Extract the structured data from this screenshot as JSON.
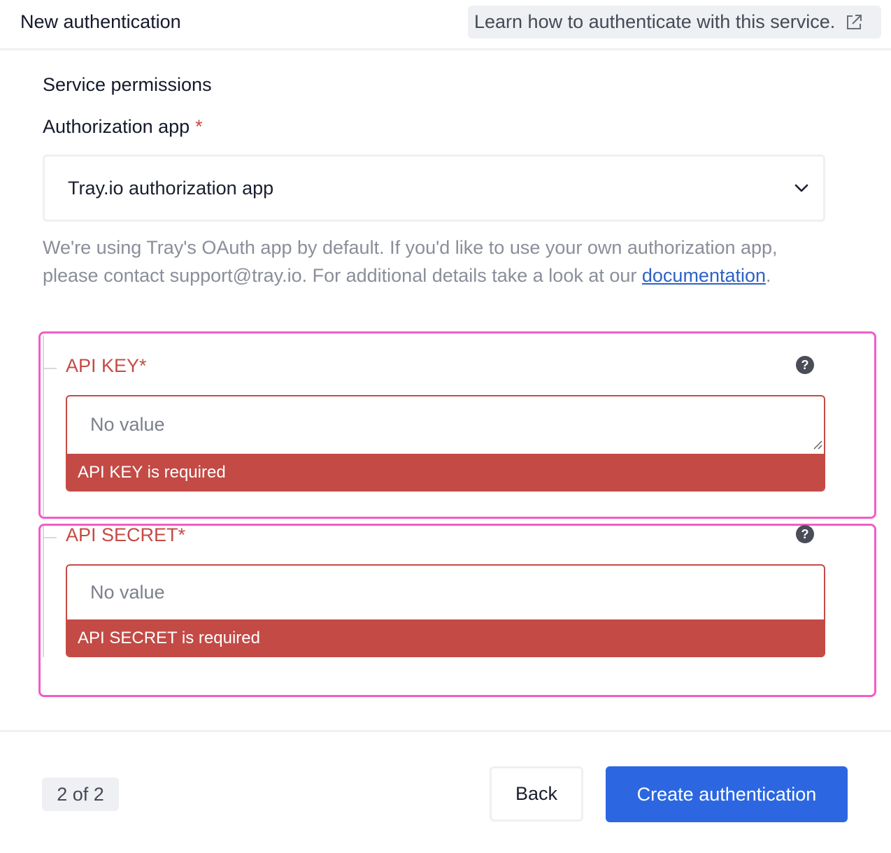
{
  "header": {
    "title": "New authentication",
    "learn_link": "Learn how to authenticate with this service.",
    "learn_link_icon": "external-link-icon"
  },
  "permissions": {
    "section_title": "Service permissions",
    "auth_app_label": "Authorization app",
    "required_marker": "*",
    "auth_app_selected": "Tray.io authorization app",
    "help_text_before_link": "We're using Tray's OAuth app by default. If you'd like to use your own authorization app, please contact support@tray.io. For additional details take a look at our ",
    "help_link_text": "documentation",
    "help_text_after_link": "."
  },
  "fields": [
    {
      "label": "API KEY*",
      "placeholder": "No value",
      "error": "API KEY is required",
      "help_icon": "question-circle-icon"
    },
    {
      "label": "API SECRET*",
      "placeholder": "No value",
      "error": "API SECRET is required",
      "help_icon": "question-circle-icon"
    }
  ],
  "footer": {
    "step": "2 of 2",
    "back_label": "Back",
    "create_label": "Create authentication"
  },
  "colors": {
    "primary": "#2c67e1",
    "error": "#c44b45",
    "highlight": "#f15cc8"
  }
}
